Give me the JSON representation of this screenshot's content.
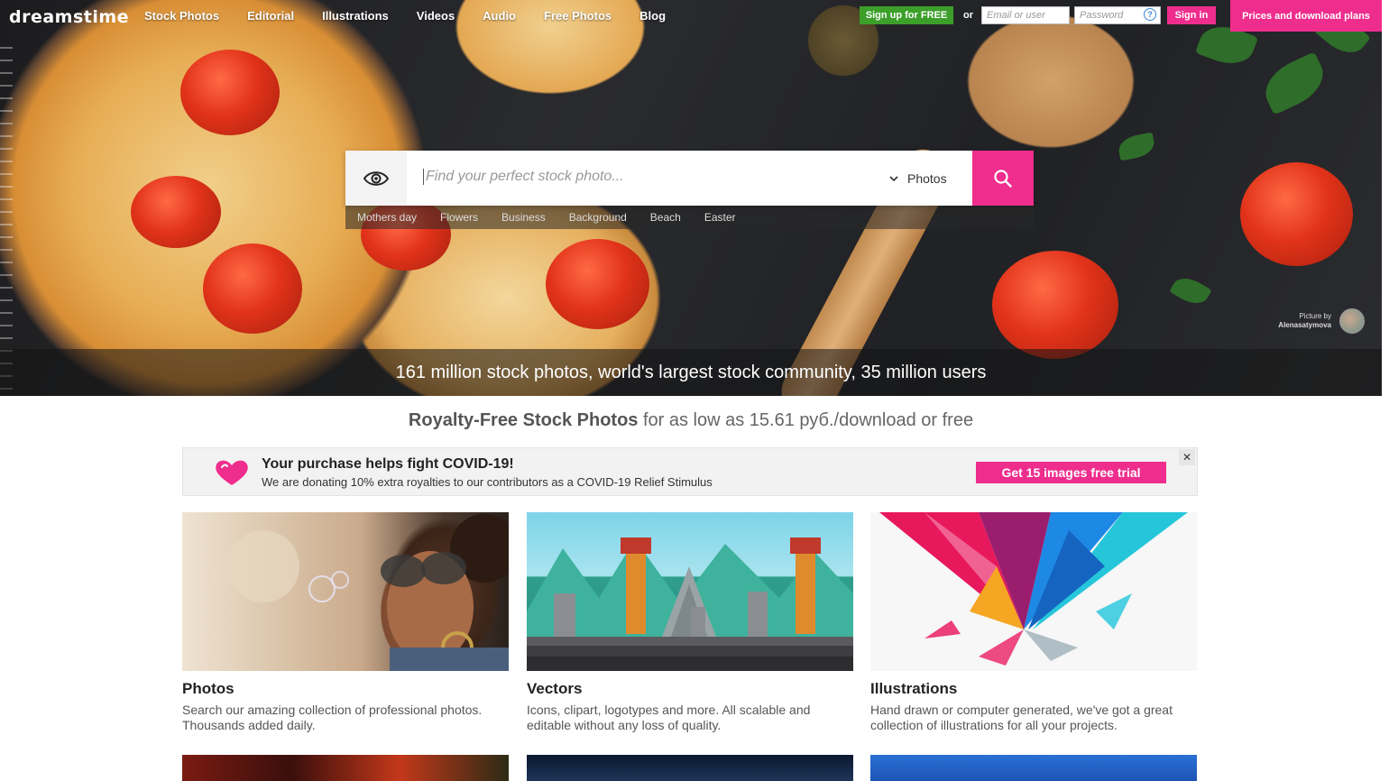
{
  "brand": {
    "logo_text": "dreamstime",
    "accent": "#ef2d8d",
    "green": "#3b9f29"
  },
  "nav": {
    "items": [
      "Stock Photos",
      "Editorial",
      "Illustrations",
      "Videos",
      "Audio",
      "Free Photos",
      "Blog"
    ],
    "signup_label": "Sign up for FREE",
    "or_label": "or",
    "email_placeholder": "Email or user",
    "password_placeholder": "Password",
    "help_icon": "?",
    "signin_label": "Sign in",
    "prices_label": "Prices and download plans"
  },
  "search": {
    "placeholder": "Find your perfect stock photo...",
    "type_selected": "Photos",
    "suggestions": [
      "Mothers day",
      "Flowers",
      "Business",
      "Background",
      "Beach",
      "Easter"
    ]
  },
  "hero": {
    "credit_line1": "Picture by",
    "credit_line2": "Alenasatymova",
    "banner": "161 million stock photos, world's largest stock community, 35 million users"
  },
  "tagline": {
    "bold": "Royalty-Free Stock Photos",
    "rest": "for as low as 15.61 руб./download or free"
  },
  "covid": {
    "title": "Your purchase helps fight COVID-19!",
    "text": "We are donating 10% extra royalties to our contributors as a COVID-19 Relief Stimulus",
    "button": "Get 15 images free trial",
    "close": "✕"
  },
  "cards": [
    {
      "title": "Photos",
      "desc": "Search our amazing collection of professional photos. Thousands added daily."
    },
    {
      "title": "Vectors",
      "desc": "Icons, clipart, logotypes and more. All scalable and editable without any loss of quality."
    },
    {
      "title": "Illustrations",
      "desc": "Hand drawn or computer generated, we've got a great collection of illustrations for all your projects."
    }
  ]
}
